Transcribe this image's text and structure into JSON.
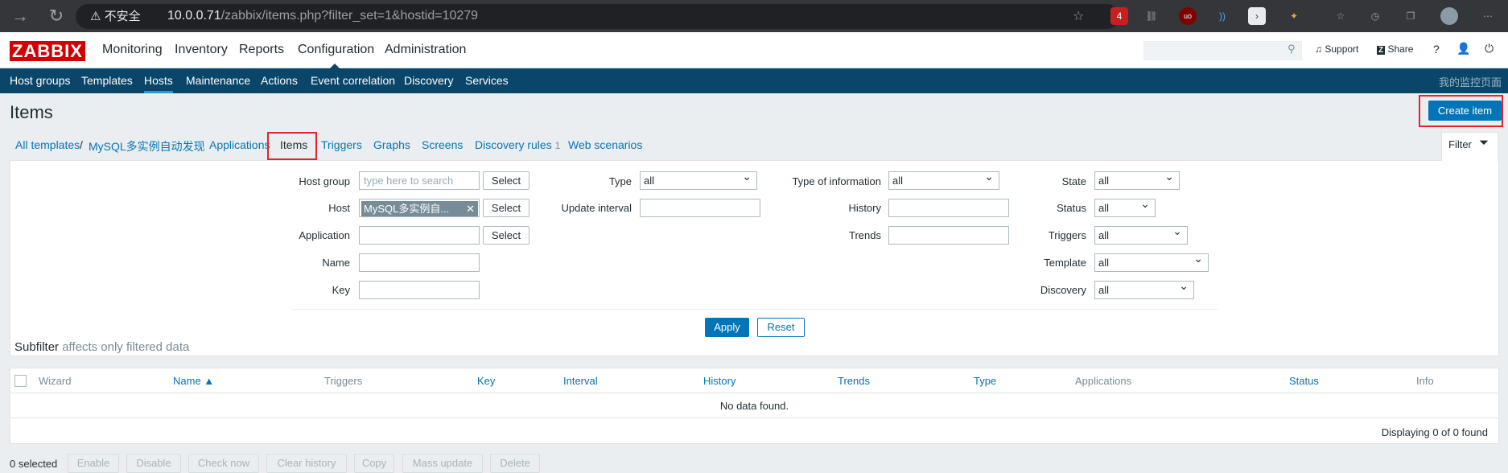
{
  "browser": {
    "security_label": "不安全",
    "url_host": "10.0.0.71",
    "url_path": "/zabbix/items.php?filter_set=1&hostid=10279",
    "badge_count": "4"
  },
  "topnav": {
    "logo": "ZABBIX",
    "menu": [
      "Monitoring",
      "Inventory",
      "Reports",
      "Configuration",
      "Administration"
    ],
    "support": "Support",
    "share": "Share",
    "help": "?"
  },
  "subnav": {
    "items": [
      "Host groups",
      "Templates",
      "Hosts",
      "Maintenance",
      "Actions",
      "Event correlation",
      "Discovery",
      "Services"
    ],
    "right_label": "我的监控页面"
  },
  "page": {
    "title": "Items",
    "create_button": "Create item"
  },
  "breadcrumb": {
    "all_templates": "All templates",
    "separator": "/",
    "host": "MySQL多实例自动发现",
    "tabs": [
      "Applications",
      "Items",
      "Triggers",
      "Graphs",
      "Screens",
      "Discovery rules",
      "Web scenarios"
    ],
    "discovery_count": "1"
  },
  "filter": {
    "tab_label": "Filter",
    "host_group_label": "Host group",
    "host_group_placeholder": "type here to search",
    "host_label": "Host",
    "host_chip": "MySQL多实例自...",
    "application_label": "Application",
    "name_label": "Name",
    "key_label": "Key",
    "select_label": "Select",
    "type_label": "Type",
    "type_value": "all",
    "update_interval_label": "Update interval",
    "type_of_information_label": "Type of information",
    "type_of_information_value": "all",
    "history_label": "History",
    "trends_label": "Trends",
    "state_label": "State",
    "state_value": "all",
    "status_label": "Status",
    "status_value": "all",
    "triggers_label": "Triggers",
    "triggers_value": "all",
    "template_label": "Template",
    "template_value": "all",
    "discovery_label": "Discovery",
    "discovery_value": "all",
    "apply": "Apply",
    "reset": "Reset"
  },
  "subfilter": {
    "title": "Subfilter",
    "note": "affects only filtered data"
  },
  "table": {
    "columns": [
      "Wizard",
      "Name ▲",
      "Triggers",
      "Key",
      "Interval",
      "History",
      "Trends",
      "Type",
      "Applications",
      "Status",
      "Info"
    ],
    "empty_text": "No data found.",
    "displaying": "Displaying 0 of 0 found"
  },
  "actions": {
    "selected": "0 selected",
    "buttons": [
      "Enable",
      "Disable",
      "Check now",
      "Clear history",
      "Copy",
      "Mass update",
      "Delete"
    ]
  },
  "colors": {
    "brand": "#d40000",
    "primary": "#0275b8",
    "subnav_bg": "#0a466a",
    "highlight_box": "#e2242f"
  }
}
